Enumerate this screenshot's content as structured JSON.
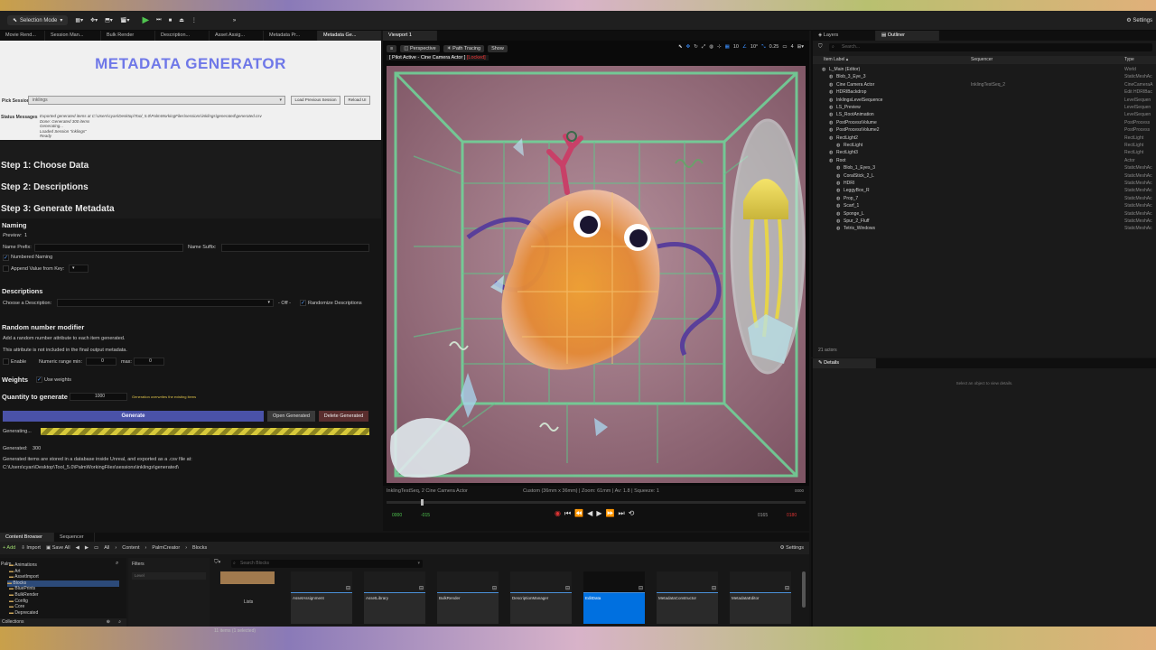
{
  "toolbar": {
    "mode": "Selection Mode",
    "settings": "Settings"
  },
  "tabs": [
    "Movie Rend...",
    "Session Man...",
    "Bulk Render",
    "Description...",
    "Asset Assig...",
    "Metadata Pr...",
    "Metadata Ge..."
  ],
  "viewport_tab": "Viewport 1",
  "generator": {
    "title": "METADATA GENERATOR",
    "pick_label": "Pick Session",
    "pick_value": "inklings",
    "load_btn": "Load Previous Session",
    "reload_btn": "Reload UI",
    "status_label": "Status Messages",
    "status_lines": [
      "Exported generated items at C:\\Users\\cyan\\Desktop\\Tool_5.0\\PalmWorkingFiles\\sessions\\inklings\\generated\\generated.csv",
      "Done: Generated 300 items",
      "Generating...",
      "Loaded Session \"inklings\"",
      "Ready"
    ],
    "step1": "Step 1: Choose Data",
    "step2": "Step 2: Descriptions",
    "step3": "Step 3: Generate Metadata",
    "naming": {
      "heading": "Naming",
      "preview_label": "Preview:",
      "preview_value": "1",
      "prefix_label": "Name Prefix:",
      "suffix_label": "Name Suffix:",
      "numbered": "Numbered Naming",
      "append": "Append Value from Key:"
    },
    "descriptions": {
      "heading": "Descriptions",
      "choose_label": "Choose a Description:",
      "off_label": "- Off -",
      "randomize": "Randomize Descriptions"
    },
    "random": {
      "heading": "Random number modifier",
      "line1": "Add a random number attribute to each item generated.",
      "line2": "This attribute is not included in the final output metadata.",
      "enable": "Enable",
      "range_label": "Numeric range min:",
      "min_value": "0",
      "max_label": "max:",
      "max_value": "0"
    },
    "weights": {
      "heading": "Weights",
      "use": "Use weights"
    },
    "quantity": {
      "label": "Quantity to generate",
      "value": "1000",
      "note": "Generation overwrites the existing items"
    },
    "generate_btn": "Generate",
    "open_btn": "Open Generated",
    "delete_btn": "Delete Generated",
    "progress_label": "Generating...",
    "progress_value": 1.0,
    "generated_label": "Generated:",
    "generated_value": "300",
    "footer_line1": "Generated items are stored in a database inside Unreal, and exported as a .csv file at:",
    "footer_line2": "C:\\Users\\cyan\\Desktop\\Tool_5.0\\PalmWorkingFiles\\sessions\\inklings\\generated\\"
  },
  "viewport": {
    "perspective": "Perspective",
    "path_tracing": "Path Tracing",
    "show": "Show",
    "pilot": "[ Pilot Active - Cine Camera Actor ]",
    "locked": "[Locked]",
    "grid_value": "10",
    "angle_value": "10°",
    "scale_value": "0.25",
    "cam_speed": "4",
    "seq_name": "InklingTestSeq, 2 Cine Camera Actor",
    "cam_info": "Custom (36mm x 36mm) | Zoom: 61mm | Av: 1.8 | Squeeze: 1",
    "frame_right": "0000",
    "time_start": "0000",
    "time_a": "-015",
    "time_b": "0165",
    "time_end": "0180"
  },
  "outliner": {
    "tab1": "Layers",
    "tab2": "Outliner",
    "search_placeholder": "Search...",
    "col_label": "Item Label ▴",
    "col_seq": "Sequencer",
    "col_type": "Type",
    "rows": [
      {
        "name": "L_Main (Editor)",
        "type": "World",
        "seq": "",
        "indent": 0
      },
      {
        "name": "Blob_3_Eye_3",
        "type": "StaticMeshAc",
        "seq": "",
        "indent": 1
      },
      {
        "name": "Cine Camera Actor",
        "type": "CineCameraA",
        "seq": "InklingTestSeq_2",
        "indent": 1
      },
      {
        "name": "HDRIBackdrop",
        "type": "Edit HDRIBac",
        "seq": "",
        "indent": 1
      },
      {
        "name": "InklingsLevelSequence",
        "type": "LevelSequen",
        "seq": "",
        "indent": 1
      },
      {
        "name": "LS_Preview",
        "type": "LevelSequen",
        "seq": "",
        "indent": 1
      },
      {
        "name": "LS_RootAnimation",
        "type": "LevelSequen",
        "seq": "",
        "indent": 1
      },
      {
        "name": "PostProcessVolume",
        "type": "PostProcess",
        "seq": "",
        "indent": 1
      },
      {
        "name": "PostProcessVolume2",
        "type": "PostProcess",
        "seq": "",
        "indent": 1
      },
      {
        "name": "RectLight2",
        "type": "RectLight",
        "seq": "",
        "indent": 1
      },
      {
        "name": "RectLight",
        "type": "RectLight",
        "seq": "",
        "indent": 2
      },
      {
        "name": "RectLight3",
        "type": "RectLight",
        "seq": "",
        "indent": 1
      },
      {
        "name": "Root",
        "type": "Actor",
        "seq": "",
        "indent": 1
      },
      {
        "name": "Blob_1_Eyes_3",
        "type": "StaticMeshAc",
        "seq": "",
        "indent": 2
      },
      {
        "name": "CoralStick_2_L",
        "type": "StaticMeshAc",
        "seq": "",
        "indent": 2
      },
      {
        "name": "HDRI",
        "type": "StaticMeshAc",
        "seq": "",
        "indent": 2
      },
      {
        "name": "LeggyBox_R",
        "type": "StaticMeshAc",
        "seq": "",
        "indent": 2
      },
      {
        "name": "Prop_7",
        "type": "StaticMeshAc",
        "seq": "",
        "indent": 2
      },
      {
        "name": "Scarf_1",
        "type": "StaticMeshAc",
        "seq": "",
        "indent": 2
      },
      {
        "name": "Sponge_L",
        "type": "StaticMeshAc",
        "seq": "",
        "indent": 2
      },
      {
        "name": "Spur_2_Fluff",
        "type": "StaticMeshAc",
        "seq": "",
        "indent": 2
      },
      {
        "name": "Tetris_Windows",
        "type": "StaticMeshAc",
        "seq": "",
        "indent": 2
      }
    ],
    "count": "21 actors"
  },
  "details": {
    "tab": "Details",
    "empty": "Select an object to view details."
  },
  "content_browser": {
    "tab1": "Content Browser",
    "tab2": "Sequencer",
    "add": "+ Add",
    "import": "Import",
    "save_all": "Save All",
    "path_all": "All",
    "path": [
      "Content",
      "PalmCreator",
      "Blocks"
    ],
    "settings": "Settings",
    "root": "Palm",
    "tree": [
      "Animations",
      "Art",
      "AssetImport",
      "Blocks",
      "BluePrints",
      "BulkRender",
      "Config",
      "Core",
      "Deprecated"
    ],
    "collections": "Collections",
    "filters": "Filters",
    "filter_chip": "Level",
    "search_placeholder": "Search Blocks",
    "lists_label": "Lists",
    "tiles": [
      "AssetAssignment",
      "AssetLibrary",
      "BulkRender",
      "DescriptionManager",
      "EditData",
      "MetadataConstructor",
      "MetadataEditor"
    ],
    "status": "11 items (1 selected)"
  },
  "colors": {
    "accent": "#6f78e8",
    "selection": "#0070e0",
    "progress": "#d7c93a"
  }
}
